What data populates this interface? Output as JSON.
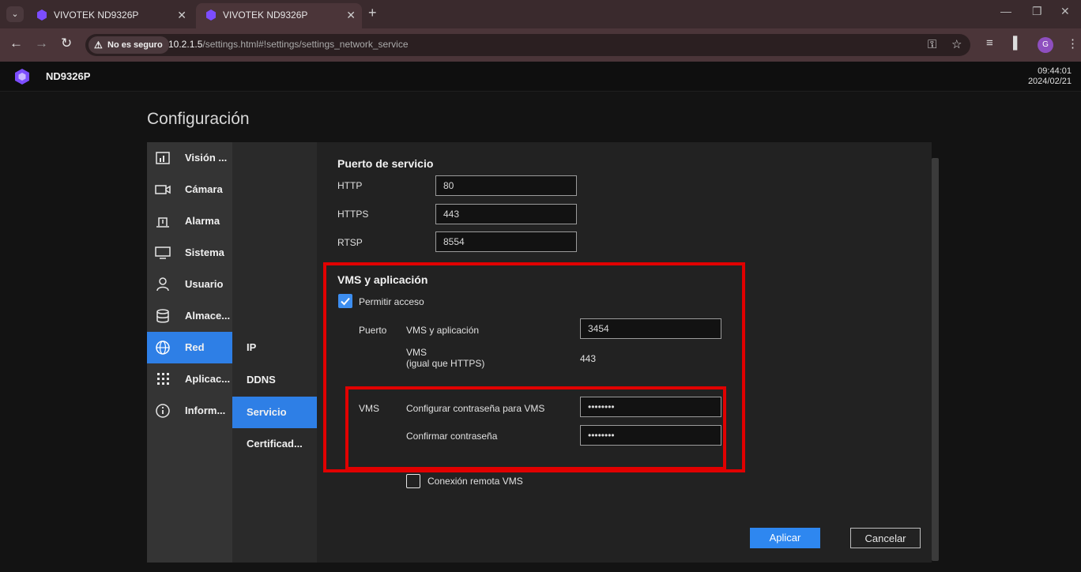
{
  "browser": {
    "tabs": [
      {
        "title": "VIVOTEK ND9326P",
        "active": false
      },
      {
        "title": "VIVOTEK ND9326P",
        "active": true
      }
    ],
    "security_chip": "No es seguro",
    "url_host": "10.2.1.5",
    "url_path": "/settings.html#!settings/settings_network_service",
    "profile_initial": "G",
    "icons": [
      "back-icon",
      "forward-icon",
      "reload-icon",
      "key-icon",
      "star-icon",
      "reading-list-icon",
      "side-panel-icon",
      "menu-icon"
    ]
  },
  "header": {
    "model": "ND9326P",
    "time": "09:44:01",
    "date": "2024/02/21"
  },
  "page": {
    "title": "Configuración"
  },
  "sidebar": {
    "items": [
      {
        "label": "Visión ...",
        "icon": "overview-icon",
        "active": false
      },
      {
        "label": "Cámara",
        "icon": "camera-icon",
        "active": false
      },
      {
        "label": "Alarma",
        "icon": "alarm-icon",
        "active": false
      },
      {
        "label": "Sistema",
        "icon": "monitor-icon",
        "active": false
      },
      {
        "label": "Usuario",
        "icon": "user-icon",
        "active": false
      },
      {
        "label": "Almace...",
        "icon": "storage-icon",
        "active": false
      },
      {
        "label": "Red",
        "icon": "globe-icon",
        "active": true
      },
      {
        "label": "Aplicac...",
        "icon": "apps-grid-icon",
        "active": false
      },
      {
        "label": "Inform...",
        "icon": "info-icon",
        "active": false
      }
    ]
  },
  "subnav": {
    "items": [
      {
        "label": "IP",
        "active": false
      },
      {
        "label": "DDNS",
        "active": false
      },
      {
        "label": "Servicio",
        "active": true
      },
      {
        "label": "Certificad...",
        "active": false
      }
    ]
  },
  "service_port": {
    "title": "Puerto de servicio",
    "http_label": "HTTP",
    "http_value": "80",
    "https_label": "HTTPS",
    "https_value": "443",
    "rtsp_label": "RTSP",
    "rtsp_value": "8554"
  },
  "vms": {
    "title": "VMS y aplicación",
    "allow_access_label": "Permitir acceso",
    "allow_access_checked": true,
    "port_label": "Puerto",
    "vms_app_label": "VMS y aplicación",
    "vms_app_value": "3454",
    "vms_same_label_line1": "VMS",
    "vms_same_label_line2": "(igual que HTTPS)",
    "vms_same_value": "443",
    "vms_label": "VMS",
    "set_password_label": "Configurar contraseña para VMS",
    "set_password_value": "••••••••",
    "confirm_password_label": "Confirmar contraseña",
    "confirm_password_value": "••••••••",
    "remote_connection_label": "Conexión remota VMS",
    "remote_connection_checked": false
  },
  "actions": {
    "apply_label": "Aplicar",
    "cancel_label": "Cancelar"
  },
  "colors": {
    "accent": "#2e7fe6",
    "highlight": "#e10000"
  }
}
